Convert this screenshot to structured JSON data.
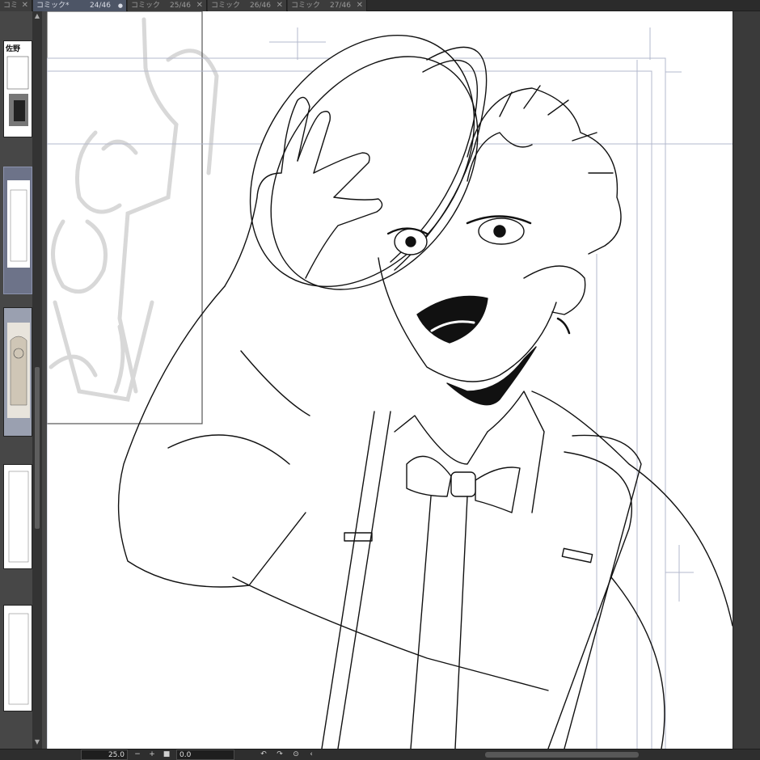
{
  "tabs": [
    {
      "name": "コミ",
      "page": "",
      "active": false
    },
    {
      "name": "コミック*",
      "page": "24/46",
      "active": true,
      "modified_dot": "●"
    },
    {
      "name": "コミック",
      "page": "25/46",
      "active": false
    },
    {
      "name": "コミック",
      "page": "26/46",
      "active": false
    },
    {
      "name": "コミック",
      "page": "27/46",
      "active": false
    }
  ],
  "close_glyph": "✕",
  "strip": {
    "scroll_up": "▲",
    "scroll_down": "▼",
    "thumbs": [
      {
        "label": "佐野",
        "selected": false
      },
      {
        "label": "",
        "selected": true
      },
      {
        "label": "",
        "selected": false
      },
      {
        "label": "",
        "selected": false
      },
      {
        "label": "",
        "selected": false
      }
    ]
  },
  "statusbar": {
    "zoom": "25.0",
    "zoom_out": "−",
    "zoom_in": "+",
    "fit": "■",
    "rotation": "0.0",
    "rotate_left": "↶",
    "rotate_right": "↷",
    "reset": "⊙",
    "collapse": "‹"
  },
  "colors": {
    "accent_tab": "#4d5566",
    "guide_blue": "#9aa4c8",
    "sketch_gray": "#d6d6d6"
  }
}
